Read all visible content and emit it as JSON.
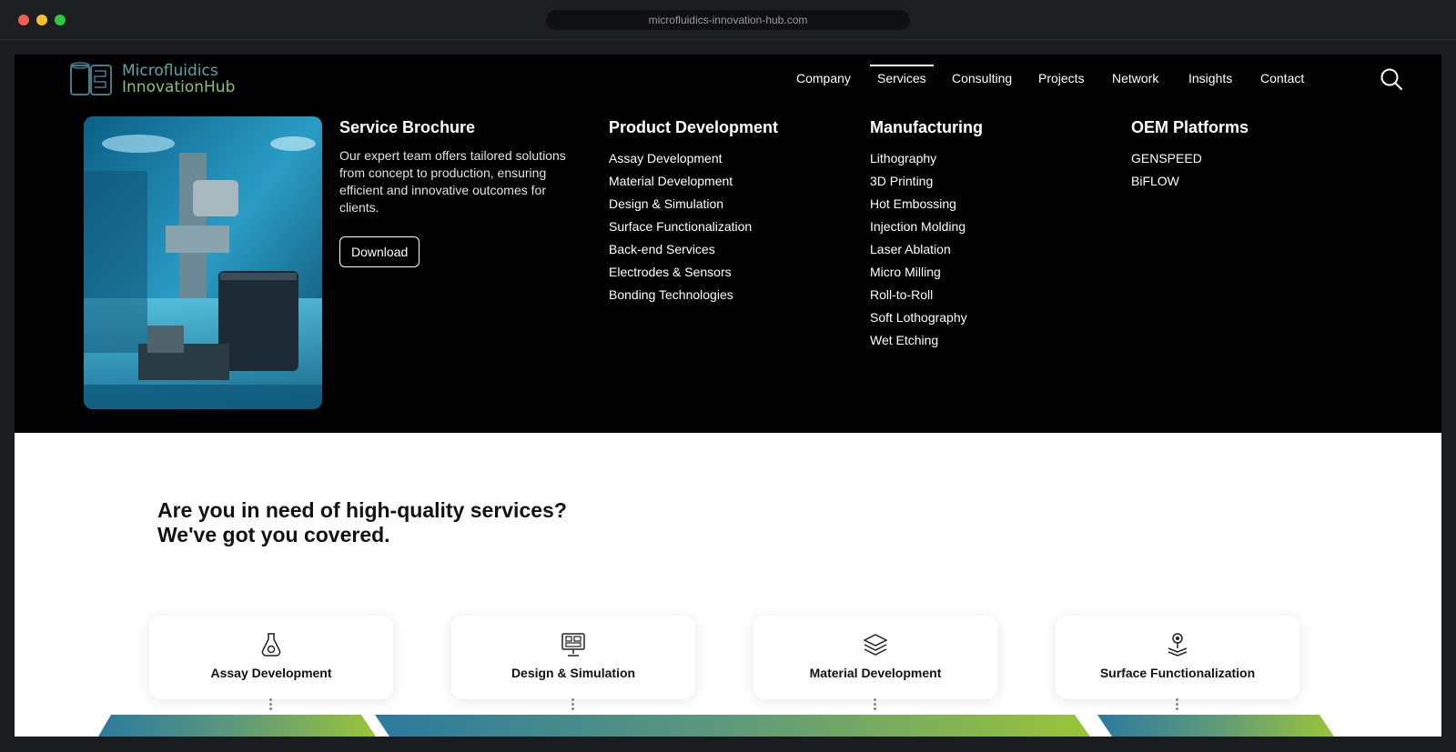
{
  "browser": {
    "url": "microfluidics-innovation-hub.com"
  },
  "logo": {
    "line1": "Microfluidics",
    "line2": "InnovationHub"
  },
  "nav": {
    "items": [
      {
        "label": "Company",
        "active": false
      },
      {
        "label": "Services",
        "active": true
      },
      {
        "label": "Consulting",
        "active": false
      },
      {
        "label": "Projects",
        "active": false
      },
      {
        "label": "Network",
        "active": false
      },
      {
        "label": "Insights",
        "active": false
      },
      {
        "label": "Contact",
        "active": false
      }
    ]
  },
  "mega_menu": {
    "brochure": {
      "title": "Service Brochure",
      "text": "Our expert team offers tailored solutions from concept to production, ensuring efficient and innovative outcomes for clients.",
      "button": "Download"
    },
    "product_development": {
      "title": "Product Development",
      "items": [
        "Assay Development",
        "Material Development",
        "Design & Simulation",
        "Surface Functionalization",
        "Back-end Services",
        "Electrodes & Sensors",
        "Bonding Technologies"
      ]
    },
    "manufacturing": {
      "title": "Manufacturing",
      "items": [
        "Lithography",
        "3D Printing",
        "Hot Embossing",
        "Injection Molding",
        "Laser Ablation",
        "Micro Milling",
        "Roll-to-Roll",
        "Soft Lothography",
        "Wet Etching"
      ]
    },
    "oem_platforms": {
      "title": "OEM Platforms",
      "items": [
        "GENSPEED",
        "BiFLOW"
      ]
    }
  },
  "main": {
    "headline_line1": "Are you in need of high-quality services?",
    "headline_line2": "We've got you covered.",
    "cards": [
      {
        "label": "Assay Development",
        "icon": "flask-icon"
      },
      {
        "label": "Design & Simulation",
        "icon": "monitor-chip-icon"
      },
      {
        "label": "Material Development",
        "icon": "layers-icon"
      },
      {
        "label": "Surface Functionalization",
        "icon": "surface-pin-icon"
      }
    ]
  },
  "colors": {
    "teal": "#2b7f9e",
    "green": "#8ec33f",
    "logo_teal": "#5aa7a6",
    "logo_green": "#8ec25a"
  }
}
